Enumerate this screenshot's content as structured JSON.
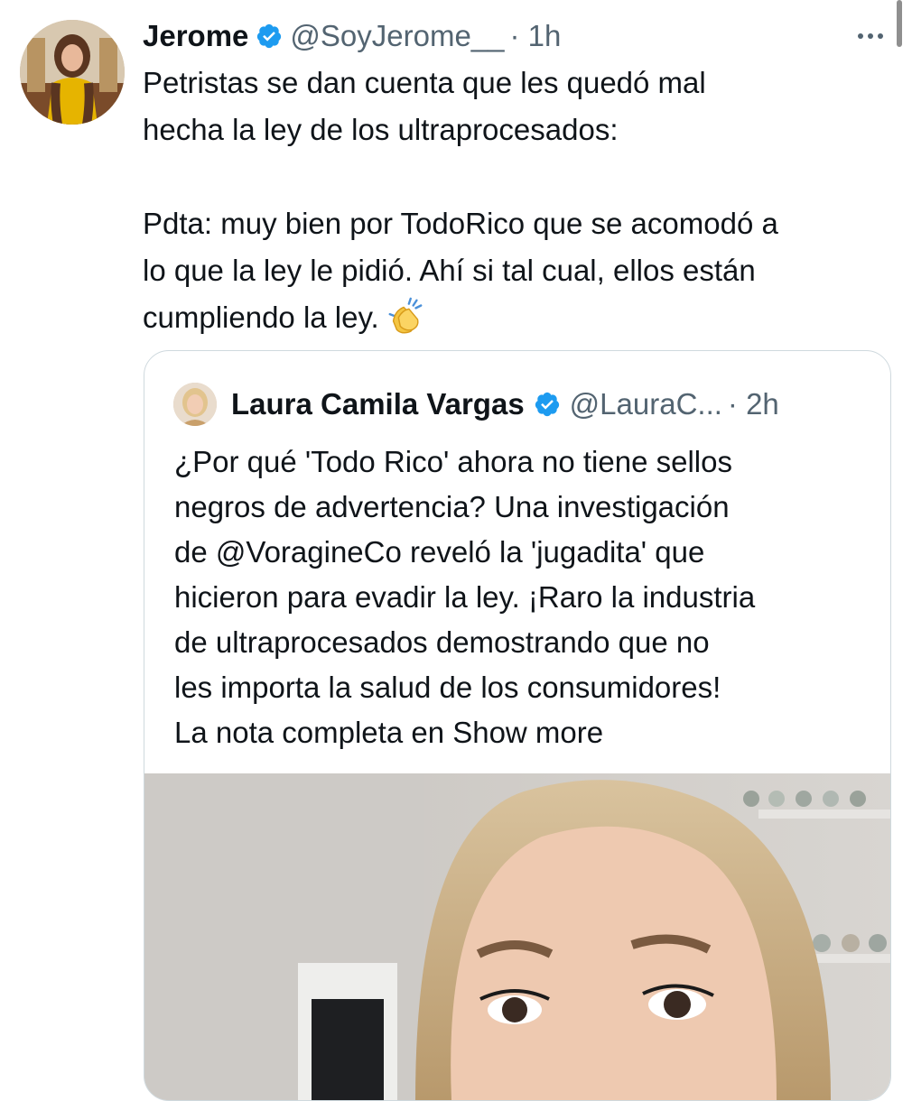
{
  "tweet": {
    "author_name": "Jerome",
    "handle": "@SoyJerome__",
    "time": "· 1h",
    "text_lines": [
      "Petristas se dan cuenta que les quedó mal",
      "hecha la ley de los ultraprocesados:"
    ],
    "text_lines_2": [
      "Pdta: muy bien por TodoRico que se acomodó a",
      "lo que la ley le pidió. Ahí si tal cual, ellos están",
      "cumpliendo la ley."
    ]
  },
  "quote": {
    "author_name": "Laura Camila Vargas",
    "handle": "@LauraC...",
    "time": "· 2h",
    "text_lines": [
      "¿Por qué 'Todo Rico' ahora no tiene sellos",
      "negros de advertencia? Una investigación",
      "de @VoragineCo reveló la 'jugadita' que",
      "hicieron para evadir la ley. ¡Raro la industria",
      "de ultraprocesados demostrando que no",
      "les importa la salud de los consumidores!",
      "La nota completa en Show more"
    ]
  },
  "icons": {
    "verified": "verified-badge-icon",
    "more": "more-options-icon",
    "emoji": "clapping-hands-emoji"
  },
  "colors": {
    "text": "#0f1419",
    "muted": "#536471",
    "verified_blue": "#1d9bf0",
    "border": "#cfd9de"
  }
}
